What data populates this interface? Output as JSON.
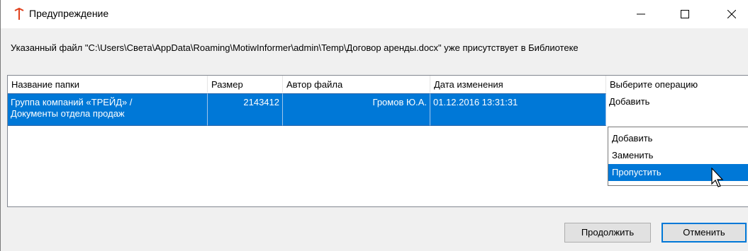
{
  "window": {
    "title": "Предупреждение",
    "message": "Указанный файл \"C:\\Users\\Света\\AppData\\Roaming\\MotiwInformer\\admin\\Temp\\Договор аренды.docx\" уже присутствует в Библиотеке",
    "controls": {
      "minimize": "—",
      "maximize": "☐",
      "close": "✕"
    }
  },
  "grid": {
    "columns": [
      "Название папки",
      "Размер",
      "Автор файла",
      "Дата изменения",
      "Выберите операцию"
    ],
    "rows": [
      {
        "folder_line1": "Группа компаний «ТРЕЙД» /",
        "folder_line2": "Документы отдела продаж",
        "size": "2143412",
        "author": "Громов Ю.А.",
        "date": "01.12.2016 13:31:31",
        "operation": "Добавить"
      }
    ]
  },
  "operation_dropdown": {
    "options": [
      "Добавить",
      "Заменить",
      "Пропустить"
    ],
    "highlighted": "Пропустить"
  },
  "buttons": {
    "continue": "Продолжить",
    "cancel": "Отменить"
  },
  "colors": {
    "selection": "#0078d7",
    "app_icon": "#e0401c"
  },
  "icons": {
    "app": "upload-arrow-icon",
    "cursor": "mouse-pointer-icon"
  }
}
